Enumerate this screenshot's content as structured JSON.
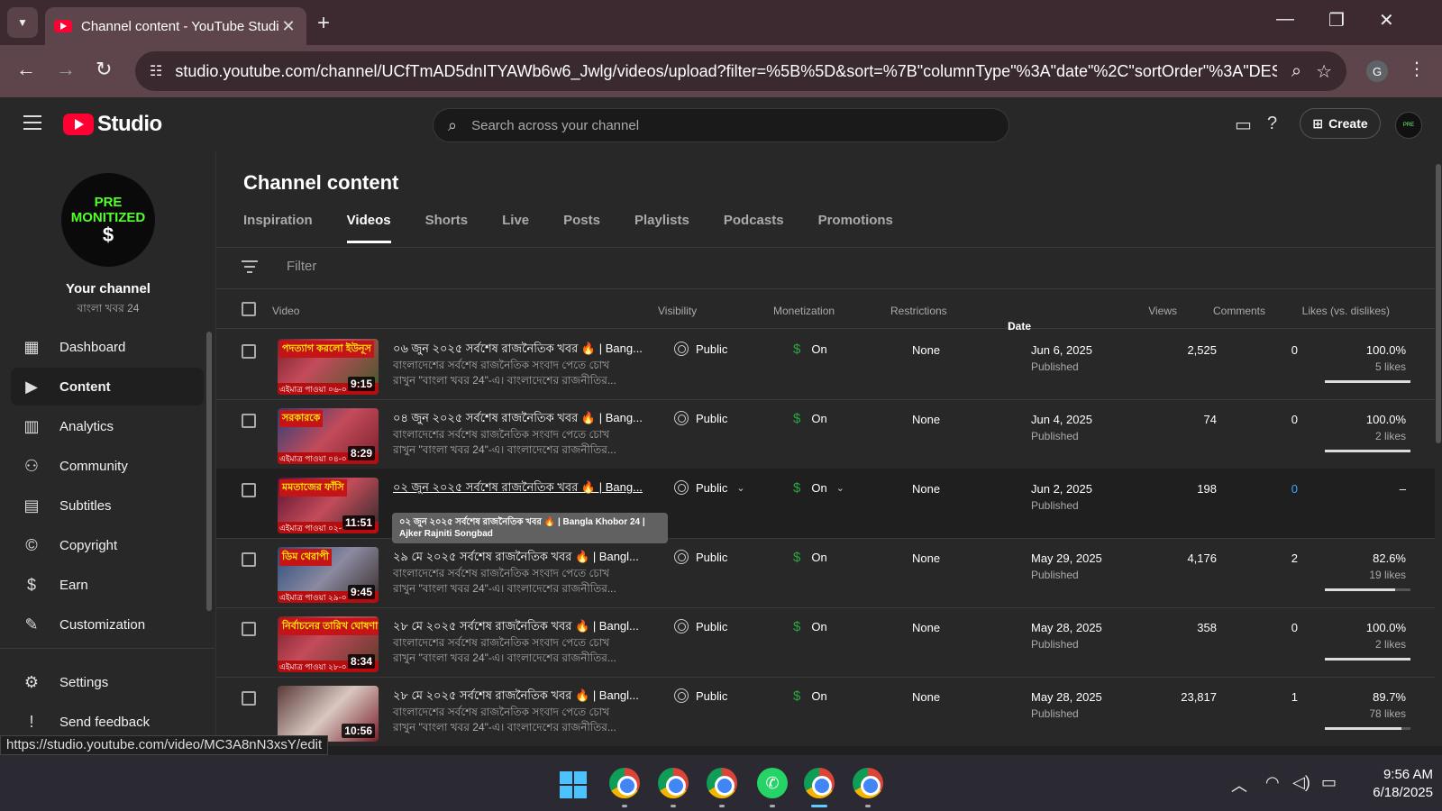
{
  "browser": {
    "tab_title": "Channel content - YouTube Studio",
    "close_glyph": "✕",
    "new_tab_glyph": "+",
    "url": "studio.youtube.com/channel/UCfTmAD5dnITYAWb6w6_Jwlg/videos/upload?filter=%5B%5D&sort=%7B\"columnType\"%3A\"date\"%2C\"sortOrder\"%3A\"DES...",
    "profile_letter": "G",
    "status_url": "https://studio.youtube.com/video/MC3A8nN3xsY/edit"
  },
  "studio": {
    "logo_text": "Studio",
    "search_placeholder": "Search across your channel",
    "create_label": "Create"
  },
  "sidebar": {
    "avatar_line1": "PRE",
    "avatar_line2": "MONITIZED",
    "your_channel": "Your channel",
    "channel_name": "বাংলা খবর 24",
    "items": [
      {
        "label": "Dashboard",
        "icon": "dashboard-icon",
        "glyph": "▦"
      },
      {
        "label": "Content",
        "icon": "content-icon",
        "glyph": "▶"
      },
      {
        "label": "Analytics",
        "icon": "analytics-icon",
        "glyph": "▥"
      },
      {
        "label": "Community",
        "icon": "community-icon",
        "glyph": "⚇"
      },
      {
        "label": "Subtitles",
        "icon": "subtitles-icon",
        "glyph": "▤"
      },
      {
        "label": "Copyright",
        "icon": "copyright-icon",
        "glyph": "©"
      },
      {
        "label": "Earn",
        "icon": "earn-icon",
        "glyph": "$"
      },
      {
        "label": "Customization",
        "icon": "customization-icon",
        "glyph": "✎"
      },
      {
        "label": "Settings",
        "icon": "settings-icon",
        "glyph": "⚙"
      },
      {
        "label": "Send feedback",
        "icon": "feedback-icon",
        "glyph": "!"
      }
    ]
  },
  "main": {
    "title": "Channel content",
    "tabs": [
      "Inspiration",
      "Videos",
      "Shorts",
      "Live",
      "Posts",
      "Playlists",
      "Podcasts",
      "Promotions"
    ],
    "active_tab": "Videos",
    "filter_placeholder": "Filter",
    "columns": {
      "video": "Video",
      "visibility": "Visibility",
      "monetization": "Monetization",
      "restrictions": "Restrictions",
      "date": "Date",
      "views": "Views",
      "comments": "Comments",
      "likes": "Likes (vs. dislikes)"
    },
    "tooltip": "০২ জুন ২০২৫ সর্বশেষ রাজনৈতিক খবর 🔥 | Bangla Khobor 24 | Ajker Rajniti Songbad",
    "rows": [
      {
        "title": "০৬ জুন ২০২৫ সর্বশেষ রাজনৈতিক খবর 🔥 | Bang...",
        "desc": "বাংলাদেশের সর্বশেষ রাজনৈতিক সংবাদ পেতে চোখ রাখুন \"বাংলা খবর 24\"-এ। বাংলাদেশের রাজনীতির...",
        "duration": "9:15",
        "thumb_caption": "পদত্যাগ করলো ইউনূস",
        "thumb_bottom": "এইমাত্র পাওয়া ০৬-০",
        "visibility": "Public",
        "monetization": "On",
        "restrictions": "None",
        "date": "Jun 6, 2025",
        "status": "Published",
        "views": "2,525",
        "comments": "0",
        "likes": "100.0%",
        "likes_count": "5 likes",
        "like_ratio": 1.0
      },
      {
        "title": "০৪ জুন ২০২৫ সর্বশেষ রাজনৈতিক খবর 🔥 | Bang...",
        "desc": "বাংলাদেশের সর্বশেষ রাজনৈতিক সংবাদ পেতে চোখ রাখুন \"বাংলা খবর 24\"-এ। বাংলাদেশের রাজনীতির...",
        "duration": "8:29",
        "thumb_caption": "সরকারকে",
        "thumb_bottom": "এইমাত্র পাওয়া ০৪-০",
        "visibility": "Public",
        "monetization": "On",
        "restrictions": "None",
        "date": "Jun 4, 2025",
        "status": "Published",
        "views": "74",
        "comments": "0",
        "likes": "100.0%",
        "likes_count": "2 likes",
        "like_ratio": 1.0
      },
      {
        "title": "০২ জুন ২০২৫ সর্বশেষ রাজনৈতিক খবর 🔥 | Bang...",
        "desc": "",
        "duration": "11:51",
        "thumb_caption": "মমতাজের ফাঁসি",
        "thumb_bottom": "এইমাত্র পাওয়া ০২-০",
        "visibility": "Public",
        "monetization": "On",
        "restrictions": "None",
        "date": "Jun 2, 2025",
        "status": "Published",
        "views": "198",
        "comments": "0",
        "likes": "–",
        "likes_count": "",
        "like_ratio": null
      },
      {
        "title": "২৯ মে ২০২৫ সর্বশেষ রাজনৈতিক খবর 🔥 | Bangl...",
        "desc": "বাংলাদেশের সর্বশেষ রাজনৈতিক সংবাদ পেতে চোখ রাখুন \"বাংলা খবর 24\"-এ। বাংলাদেশের রাজনীতির...",
        "duration": "9:45",
        "thumb_caption": "ডিম থেরাপী",
        "thumb_bottom": "এইমাত্র পাওয়া ২৯-০",
        "visibility": "Public",
        "monetization": "On",
        "restrictions": "None",
        "date": "May 29, 2025",
        "status": "Published",
        "views": "4,176",
        "comments": "2",
        "likes": "82.6%",
        "likes_count": "19 likes",
        "like_ratio": 0.826
      },
      {
        "title": "২৮ মে ২০২৫ সর্বশেষ রাজনৈতিক খবর 🔥 | Bangl...",
        "desc": "বাংলাদেশের সর্বশেষ রাজনৈতিক সংবাদ পেতে চোখ রাখুন \"বাংলা খবর 24\"-এ। বাংলাদেশের রাজনীতির...",
        "duration": "8:34",
        "thumb_caption": "নির্বাচনের তারিখ ঘোষণা",
        "thumb_bottom": "এইমাত্র পাওয়া ২৮-০",
        "visibility": "Public",
        "monetization": "On",
        "restrictions": "None",
        "date": "May 28, 2025",
        "status": "Published",
        "views": "358",
        "comments": "0",
        "likes": "100.0%",
        "likes_count": "2 likes",
        "like_ratio": 1.0
      },
      {
        "title": "২৮ মে ২০২৫ সর্বশেষ রাজনৈতিক খবর 🔥 | Bangl...",
        "desc": "বাংলাদেশের সর্বশেষ রাজনৈতিক সংবাদ পেতে চোখ রাখুন \"বাংলা খবর 24\"-এ। বাংলাদেশের রাজনীতির...",
        "duration": "10:56",
        "thumb_caption": "",
        "thumb_bottom": "",
        "visibility": "Public",
        "monetization": "On",
        "restrictions": "None",
        "date": "May 28, 2025",
        "status": "Published",
        "views": "23,817",
        "comments": "1",
        "likes": "89.7%",
        "likes_count": "78 likes",
        "like_ratio": 0.897
      }
    ]
  },
  "taskbar": {
    "time": "9:56 AM",
    "date": "6/18/2025"
  },
  "colors": {
    "accent_red": "#ff0033",
    "monetization_green": "#2ba640",
    "link_blue": "#3ea6ff",
    "tab_active_bg": "#5e454c"
  }
}
